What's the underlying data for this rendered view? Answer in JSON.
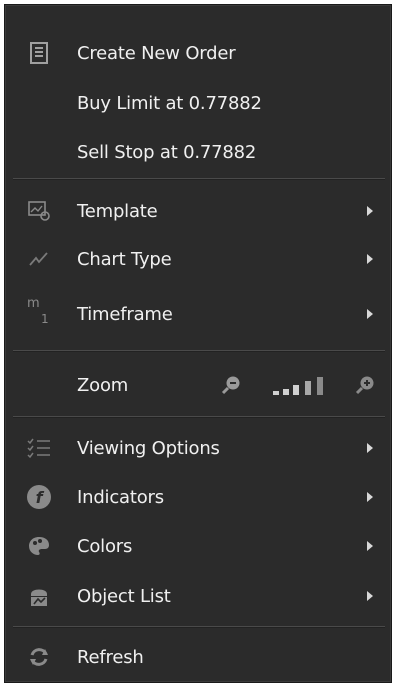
{
  "menu": {
    "items": [
      {
        "label": "Create New Order",
        "icon": "order-document-icon",
        "has_submenu": false
      },
      {
        "label": "Buy Limit at 0.77882",
        "icon": "",
        "has_submenu": false
      },
      {
        "label": "Sell Stop at 0.77882",
        "icon": "",
        "has_submenu": false
      },
      {
        "label": "Template",
        "icon": "template-icon",
        "has_submenu": true
      },
      {
        "label": "Chart Type",
        "icon": "chart-line-icon",
        "has_submenu": true
      },
      {
        "label": "Timeframe",
        "icon": "timeframe-icon",
        "icon_text": "m",
        "icon_sub": "1",
        "has_submenu": true
      },
      {
        "label": "Zoom",
        "icon": "",
        "has_submenu": false
      },
      {
        "label": "Viewing Options",
        "icon": "checklist-icon",
        "has_submenu": true
      },
      {
        "label": "Indicators",
        "icon": "indicator-f-icon",
        "icon_text": "f",
        "has_submenu": true
      },
      {
        "label": "Colors",
        "icon": "palette-icon",
        "has_submenu": true
      },
      {
        "label": "Object List",
        "icon": "object-list-icon",
        "has_submenu": true
      },
      {
        "label": "Refresh",
        "icon": "refresh-icon",
        "has_submenu": false
      }
    ],
    "zoom": {
      "zoom_out_icon": "zoom-out-icon",
      "zoom_in_icon": "zoom-in-icon",
      "level_indicator_icon": "zoom-level-bars-icon"
    }
  },
  "colors": {
    "background": "#2b2b2b",
    "text": "#f0f0f0",
    "icon": "#9a9a9a",
    "separator": "#4a4a4a"
  }
}
